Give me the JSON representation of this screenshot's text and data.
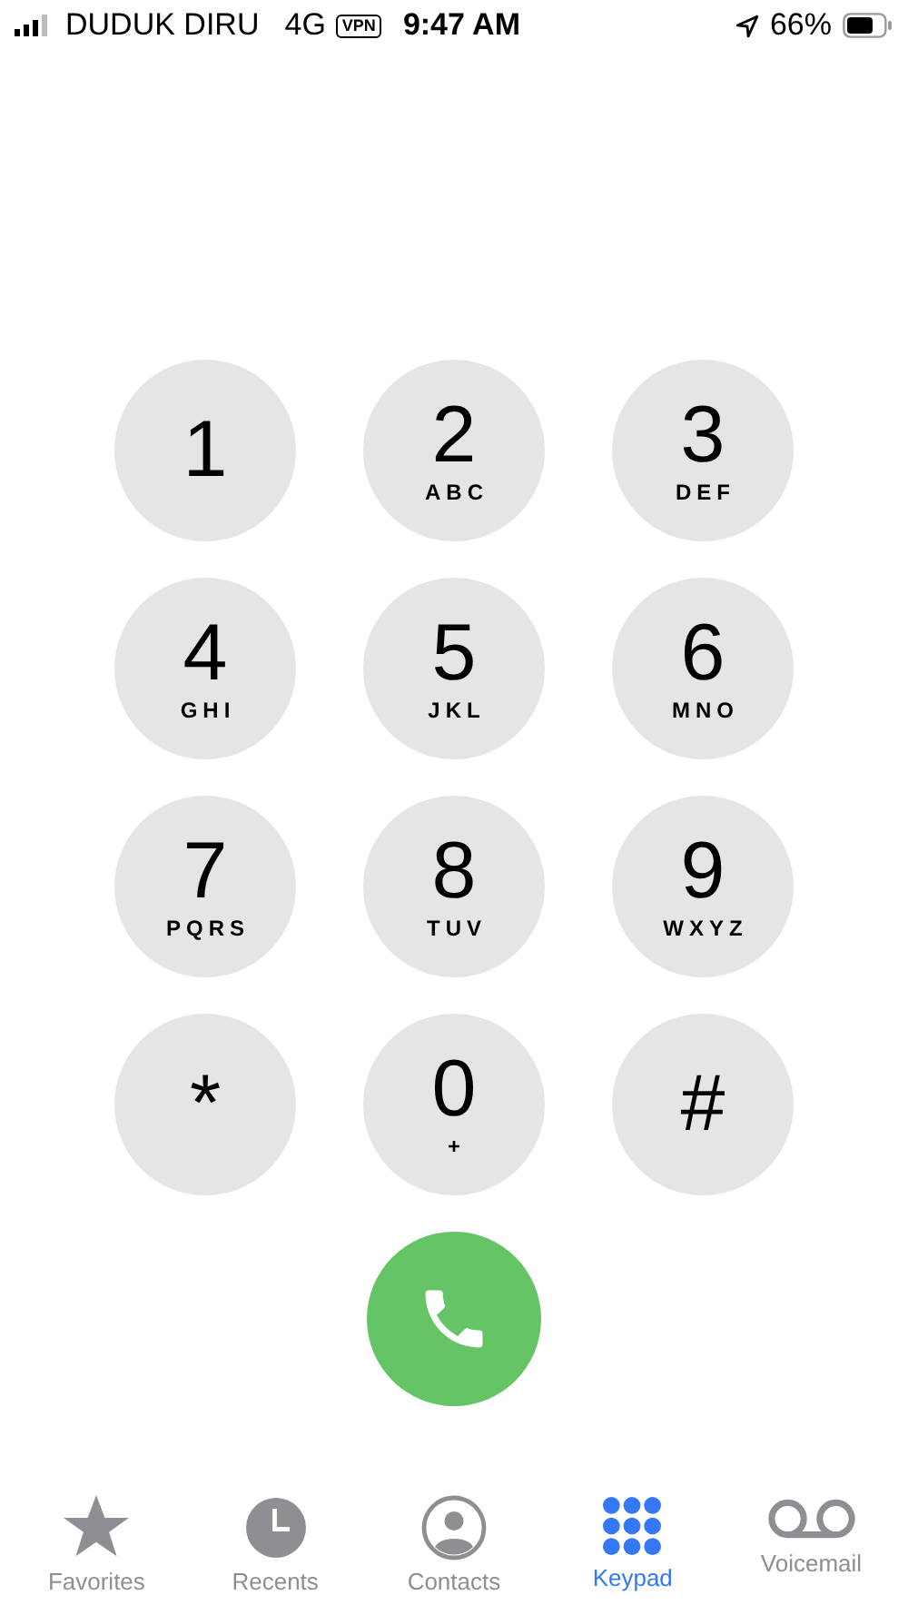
{
  "status_bar": {
    "carrier": "DUDUK DIRU",
    "network": "4G",
    "vpn": "VPN",
    "time": "9:47 AM",
    "battery": "66%"
  },
  "keys": [
    {
      "digit": "1"
    },
    {
      "digit": "2",
      "letters": "ABC"
    },
    {
      "digit": "3",
      "letters": "DEF"
    },
    {
      "digit": "4",
      "letters": "GHI"
    },
    {
      "digit": "5",
      "letters": "JKL"
    },
    {
      "digit": "6",
      "letters": "MNO"
    },
    {
      "digit": "7",
      "letters": "PQRS"
    },
    {
      "digit": "8",
      "letters": "TUV"
    },
    {
      "digit": "9",
      "letters": "WXYZ"
    },
    {
      "digit": "*"
    },
    {
      "digit": "0",
      "letters": "+"
    },
    {
      "digit": "#"
    }
  ],
  "tabs": [
    {
      "kind": "favorites",
      "label": "Favorites",
      "selected": false
    },
    {
      "kind": "recents",
      "label": "Recents",
      "selected": false
    },
    {
      "kind": "contacts",
      "label": "Contacts",
      "selected": false
    },
    {
      "kind": "keypad",
      "label": "Keypad",
      "selected": true
    },
    {
      "kind": "voicemail",
      "label": "Voicemail",
      "selected": false
    }
  ]
}
